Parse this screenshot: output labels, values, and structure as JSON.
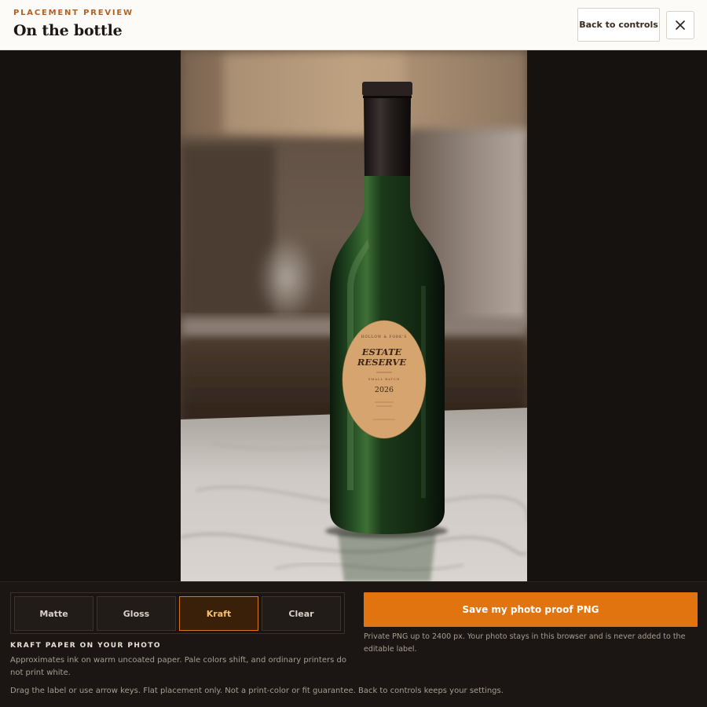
{
  "header": {
    "eyebrow": "PLACEMENT PREVIEW",
    "title": "On the bottle",
    "back_label": "Back to controls",
    "close_icon": "close-icon"
  },
  "label": {
    "eyebrow": "HOLLOW & FORK'S",
    "title_line1": "ESTATE",
    "title_line2": "RESERVE",
    "subtitle": "SMALL BATCH",
    "year": "2026"
  },
  "finishes": {
    "options": [
      "Matte",
      "Gloss",
      "Kraft",
      "Clear"
    ],
    "selected": "Kraft",
    "section_label": "KRAFT PAPER ON YOUR PHOTO",
    "description": "Approximates ink on warm uncoated paper. Pale colors shift, and ordinary printers do not print white."
  },
  "save": {
    "label": "Save my photo proof PNG",
    "note": "Private PNG up to 2400 px. Your photo stays in this browser and is never added to the editable label."
  },
  "drag_note": "Drag the label or use arrow keys. Flat placement only. Not a print-color or fit guarantee. Back to controls keeps your settings.",
  "colors": {
    "accent": "#e2740f",
    "kraft_active_border": "#d9781a",
    "label_paper": "#d6a56f"
  }
}
